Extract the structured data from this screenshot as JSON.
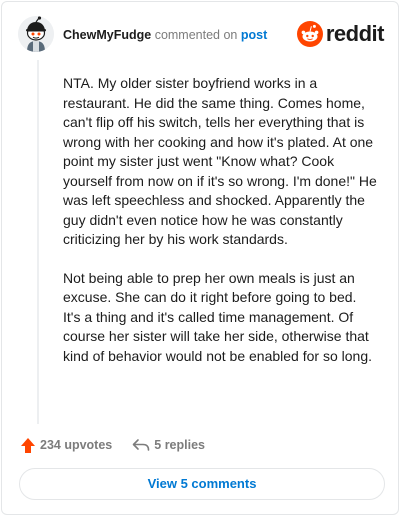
{
  "comment": {
    "username": "ChewMyFudge",
    "verb": "commented on",
    "post_link": "post",
    "brand": "reddit",
    "paragraphs": [
      "NTA. My older sister boyfriend works in a restaurant. He did the same thing. Comes home, can't flip off his switch, tells her everything that is wrong with her cooking and how it's plated. At one point my sister just went \"Know what? Cook yourself from now on if it's so wrong. I'm done!\" He was left speechless and shocked. Apparently the guy didn't even notice how he was constantly criticizing her by his work standards.",
      "Not being able to prep her own meals is just an excuse. She can do it right before going to bed. It's a thing and it's called time management. Of course her sister will take her side, otherwise that kind of behavior would not be enabled for so long."
    ],
    "upvotes_label": "234 upvotes",
    "replies_label": "5 replies",
    "view_button_label": "View 5 comments"
  },
  "icons": {
    "avatar": "snoo-avatar-icon",
    "brand": "reddit-logo-icon",
    "upvote": "upvote-arrow-icon",
    "reply": "reply-arrow-icon"
  },
  "colors": {
    "brand_orange": "#ff4500",
    "link_blue": "#0079d3",
    "muted_text": "#7c7c7c",
    "text": "#1c1c1c",
    "border": "#e4e6e8"
  }
}
